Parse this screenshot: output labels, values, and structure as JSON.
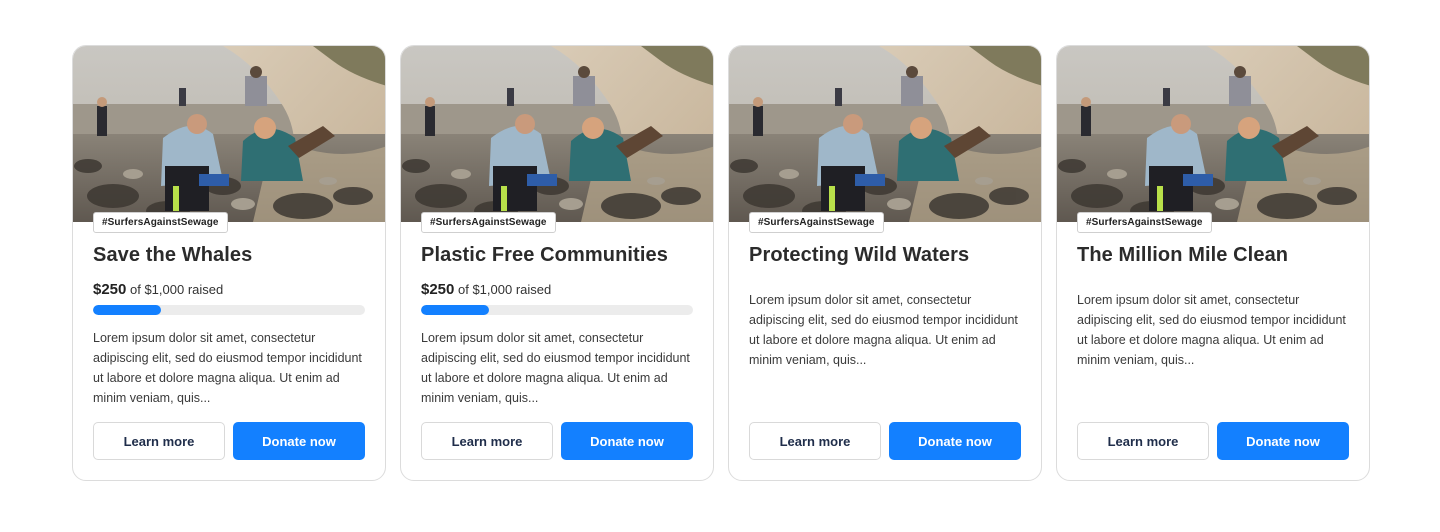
{
  "colors": {
    "accent": "#1380ff",
    "track": "#ececec",
    "border": "#dcdcdc"
  },
  "cards": [
    {
      "tag": "#SurfersAgainstSewage",
      "title": "Save the Whales",
      "raised_amount": "$250",
      "raised_text": "of $1,000 raised",
      "progress": 0.25,
      "description": "Lorem ipsum dolor sit amet, consectetur adipiscing elit, sed do eiusmod tempor incididunt ut labore et dolore magna aliqua. Ut enim ad minim veniam, quis...",
      "learn_label": "Learn more",
      "donate_label": "Donate now"
    },
    {
      "tag": "#SurfersAgainstSewage",
      "title": "Plastic Free Communities",
      "raised_amount": "$250",
      "raised_text": "of $1,000 raised",
      "progress": 0.25,
      "description": "Lorem ipsum dolor sit amet, consectetur adipiscing elit, sed do eiusmod tempor incididunt ut labore et dolore magna aliqua. Ut enim ad minim veniam, quis...",
      "learn_label": "Learn more",
      "donate_label": "Donate now"
    },
    {
      "tag": "#SurfersAgainstSewage",
      "title": "Protecting Wild Waters",
      "description": "Lorem ipsum dolor sit amet, consectetur adipiscing elit, sed do eiusmod tempor incididunt ut labore et dolore magna aliqua. Ut enim ad minim veniam, quis...",
      "learn_label": "Learn more",
      "donate_label": "Donate now"
    },
    {
      "tag": "#SurfersAgainstSewage",
      "title": "The Million Mile Clean",
      "description": "Lorem ipsum dolor sit amet, consectetur adipiscing elit, sed do eiusmod tempor incididunt ut labore et dolore magna aliqua. Ut enim ad minim veniam, quis...",
      "learn_label": "Learn more",
      "donate_label": "Donate now"
    }
  ]
}
